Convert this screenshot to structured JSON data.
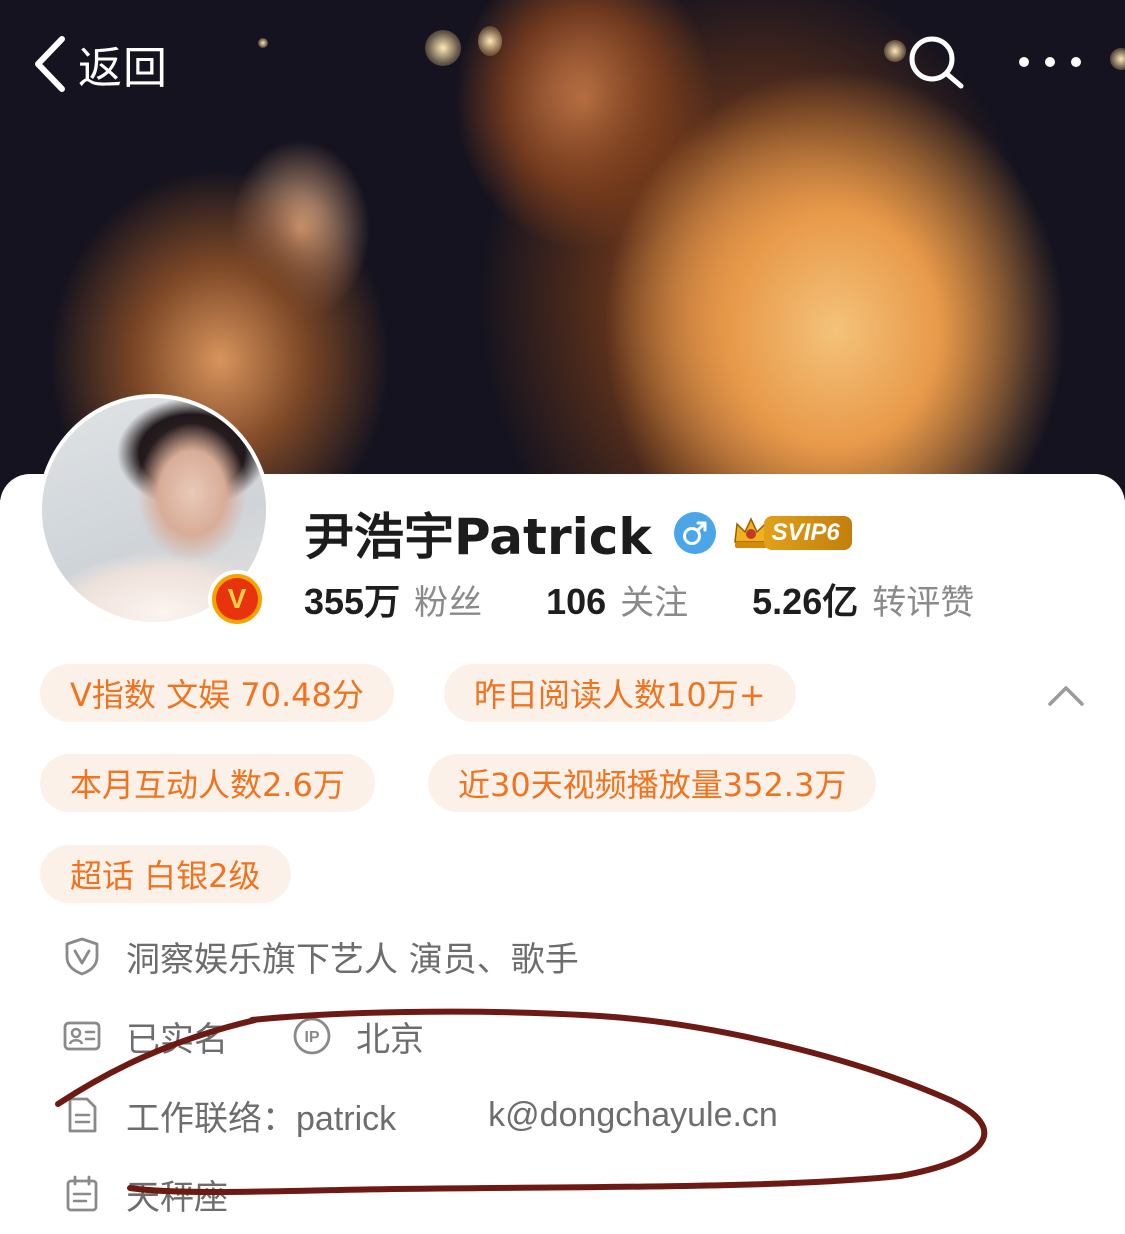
{
  "nav": {
    "back_label": "返回"
  },
  "profile": {
    "name": "尹浩宇Patrick",
    "vip_label": "SVIP6",
    "verified_badge_letter": "V",
    "stats": [
      {
        "value": "355万",
        "label": "粉丝"
      },
      {
        "value": "106",
        "label": "关注"
      },
      {
        "value": "5.26亿",
        "label": "转评赞"
      }
    ]
  },
  "pills": [
    "V指数 文娱 70.48分",
    "昨日阅读人数10万+",
    "本月互动人数2.6万",
    "近30天视频播放量352.3万",
    "超话 白银2级"
  ],
  "info": {
    "agency": "洞察娱乐旗下艺人 演员、歌手",
    "real_name": "已实名",
    "ip_location": "北京",
    "work_contact": "工作联络：patrick",
    "work_contact_domain": "k@dongchayule.cn",
    "zodiac": "天秤座"
  },
  "colors": {
    "accent_orange": "#f0731f",
    "pill_background": "#fcf1e9",
    "gender_blue": "#4aa6e8",
    "svip_gold": "#e0a11a",
    "scribble_red": "#6e1a14"
  }
}
